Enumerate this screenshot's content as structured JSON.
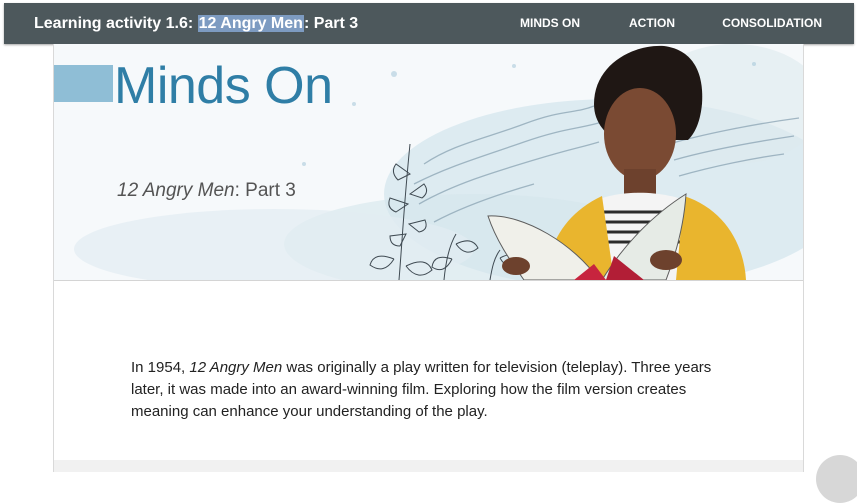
{
  "header": {
    "title_prefix": "Learning activity 1.6: ",
    "title_highlight": "12 Angry Men",
    "title_suffix": ": Part 3",
    "nav": [
      "MINDS ON",
      "ACTION",
      "CONSOLIDATION"
    ]
  },
  "banner": {
    "heading": "Minds On",
    "subtitle_italic": "12 Angry Men",
    "subtitle_rest": ": Part 3"
  },
  "content": {
    "intro_a": "In 1954, ",
    "intro_italic": "12 Angry Men",
    "intro_b": " was originally a play written for television (teleplay). Three years later, it was made into an award-winning film. Exploring how the film version creates meaning can enhance your understanding of the play."
  },
  "colors": {
    "header_bg": "#4d585c",
    "accent_blue": "#2f7ea6",
    "accent_block": "#8fbed6",
    "highlight": "#7d9bc1"
  }
}
